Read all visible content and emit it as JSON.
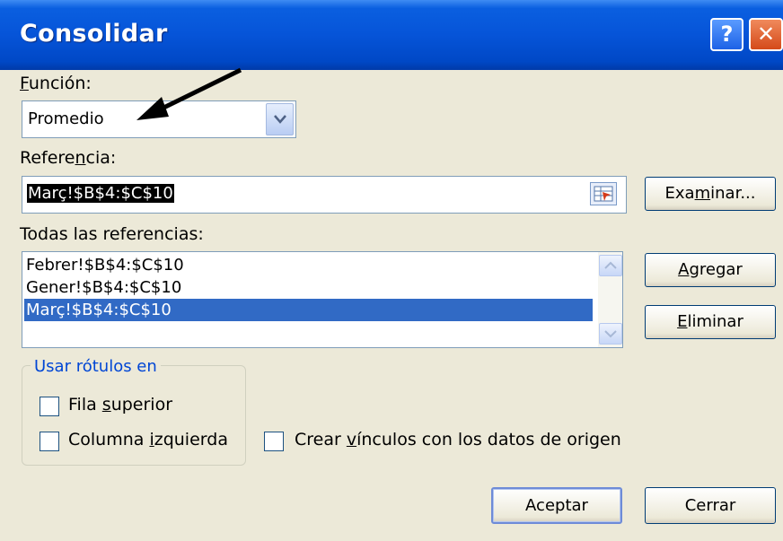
{
  "window": {
    "title": "Consolidar",
    "help_glyph": "?",
    "close_glyph": "✕"
  },
  "funcion": {
    "label_first": "F",
    "label_rest": "unción:",
    "value": "Promedio"
  },
  "referencia": {
    "label_pre": "Refere",
    "label_ul": "n",
    "label_post": "cia:",
    "value": "Març!$B$4:$C$10"
  },
  "browse": {
    "pre": "Exa",
    "ul": "m",
    "post": "inar..."
  },
  "todas": {
    "label": "Todas las referencias:",
    "items": [
      "Febrer!$B$4:$C$10",
      "Gener!$B$4:$C$10",
      "Març!$B$4:$C$10"
    ],
    "selected_index": 2
  },
  "agregar": {
    "ul": "A",
    "post": "gregar"
  },
  "eliminar": {
    "ul": "E",
    "post": "liminar"
  },
  "usar": {
    "legend": "Usar rótulos en",
    "fila_pre": "Fila ",
    "fila_ul": "s",
    "fila_post": "uperior",
    "col_pre": "Columna ",
    "col_ul": "i",
    "col_post": "zquierda"
  },
  "vinculos": {
    "pre": "Crear ",
    "ul": "v",
    "post": "ínculos con los datos de origen"
  },
  "aceptar": "Aceptar",
  "cerrar": "Cerrar",
  "colors": {
    "titlebar": "#0654d8",
    "selection": "#316ac5",
    "dialog_bg": "#ece9d8"
  }
}
